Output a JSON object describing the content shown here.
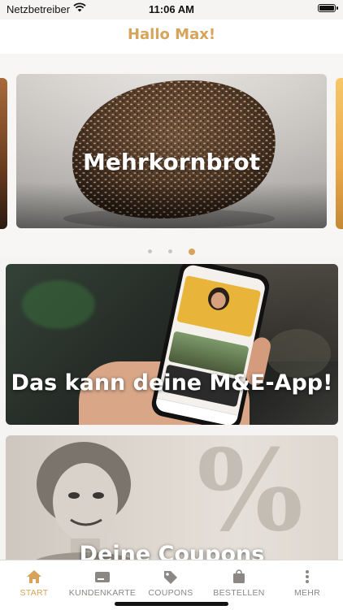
{
  "status_bar": {
    "carrier": "Netzbetreiber",
    "time": "11:06 AM",
    "wifi_icon": "wifi-icon",
    "battery_icon": "battery-icon"
  },
  "header": {
    "title": "Hallo Max!"
  },
  "carousel": {
    "slide_label": "Mehrkornbrot",
    "dot_count": 3,
    "active_index": 2
  },
  "cards": [
    {
      "label": "Das kann deine M&E-App!"
    },
    {
      "label": "Deine Coupons"
    }
  ],
  "tabbar": {
    "items": [
      {
        "label": "START",
        "icon": "home-icon",
        "active": true
      },
      {
        "label": "KUNDENKARTE",
        "icon": "card-icon",
        "active": false
      },
      {
        "label": "COUPONS",
        "icon": "tag-icon",
        "active": false
      },
      {
        "label": "BESTELLEN",
        "icon": "bag-icon",
        "active": false
      },
      {
        "label": "MEHR",
        "icon": "more-icon",
        "active": false
      }
    ]
  },
  "colors": {
    "accent": "#d6a45a",
    "inactive": "#8a8784"
  }
}
